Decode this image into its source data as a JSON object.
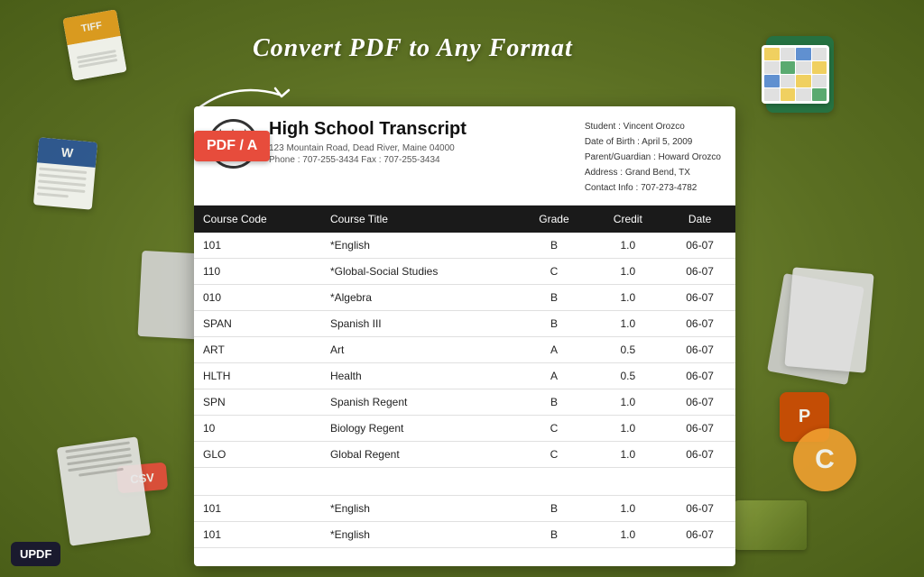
{
  "background_color": "#6b7c2e",
  "headline": "Convert PDF to Any Format",
  "pdf_badge": "PDF / A",
  "updf_label": "UPDF",
  "document": {
    "title": "High School Transcript",
    "address": "123 Mountain Road, Dead River, Maine 04000",
    "phone": "Phone : 707-255-3434    Fax : 707-255-3434",
    "student_info": {
      "student": "Student : Vincent Orozco",
      "dob": "Date of Birth : April 5, 2009",
      "parent": "Parent/Guardian : Howard Orozco",
      "address": "Address : Grand Bend, TX",
      "contact": "Contact Info : 707-273-4782"
    }
  },
  "table": {
    "headers": [
      "Course Code",
      "Course Title",
      "Grade",
      "Credit",
      "Date"
    ],
    "rows": [
      {
        "code": "101",
        "title": "*English",
        "grade": "B",
        "credit": "1.0",
        "date": "06-07"
      },
      {
        "code": "110",
        "title": "*Global-Social Studies",
        "grade": "C",
        "credit": "1.0",
        "date": "06-07"
      },
      {
        "code": "010",
        "title": "*Algebra",
        "grade": "B",
        "credit": "1.0",
        "date": "06-07"
      },
      {
        "code": "SPAN",
        "title": "Spanish III",
        "grade": "B",
        "credit": "1.0",
        "date": "06-07"
      },
      {
        "code": "ART",
        "title": "Art",
        "grade": "A",
        "credit": "0.5",
        "date": "06-07"
      },
      {
        "code": "HLTH",
        "title": "Health",
        "grade": "A",
        "credit": "0.5",
        "date": "06-07"
      },
      {
        "code": "SPN",
        "title": "Spanish Regent",
        "grade": "B",
        "credit": "1.0",
        "date": "06-07"
      },
      {
        "code": "10",
        "title": "Biology Regent",
        "grade": "C",
        "credit": "1.0",
        "date": "06-07"
      },
      {
        "code": "GLO",
        "title": "Global Regent",
        "grade": "C",
        "credit": "1.0",
        "date": "06-07"
      }
    ],
    "rows2": [
      {
        "code": "101",
        "title": "*English",
        "grade": "B",
        "credit": "1.0",
        "date": "06-07"
      },
      {
        "code": "101",
        "title": "*English",
        "grade": "B",
        "credit": "1.0",
        "date": "06-07"
      }
    ]
  }
}
